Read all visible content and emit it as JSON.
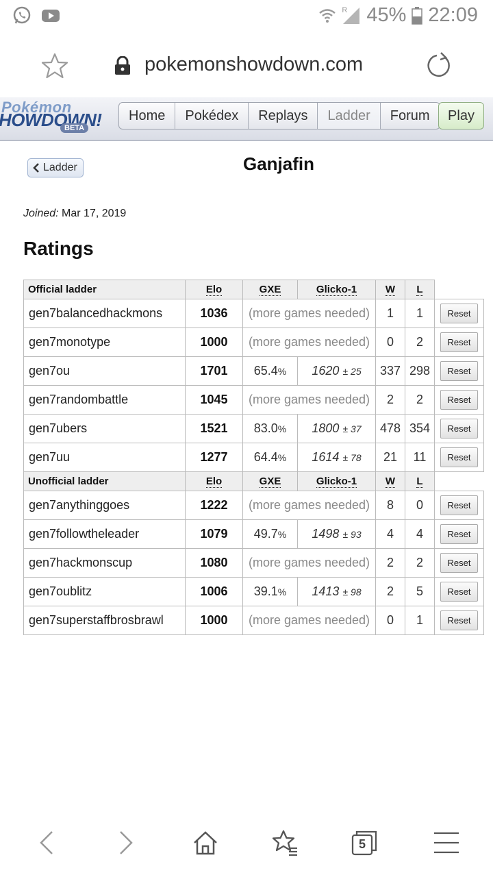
{
  "status_bar": {
    "network_label": "R",
    "battery": "45%",
    "time": "22:09",
    "left_icons": [
      "whatsapp-icon",
      "youtube-icon"
    ]
  },
  "browser": {
    "url": "pokemonshowdown.com"
  },
  "site": {
    "logo_line1": "Pokémon",
    "logo_line2": "HOWDOWN!",
    "logo_beta": "BETA",
    "nav": [
      "Home",
      "Pokédex",
      "Replays",
      "Ladder",
      "Forum"
    ],
    "nav_current": "Ladder",
    "play": "Play"
  },
  "page": {
    "back_label": "Ladder",
    "player_name": "Ganjafin",
    "joined_label": "Joined:",
    "joined_date": "Mar 17, 2019",
    "ratings_title": "Ratings"
  },
  "table": {
    "columns": {
      "elo": "Elo",
      "gxe": "GXE",
      "glicko": "Glicko-1",
      "w": "W",
      "l": "L"
    },
    "reset_label": "Reset",
    "more_games_label": "(more games needed)",
    "sections": [
      {
        "label": "Official ladder",
        "rows": [
          {
            "format": "gen7balancedhackmons",
            "elo": "1036",
            "gxe": null,
            "glicko": null,
            "glicko_dev": null,
            "w": "1",
            "l": "1"
          },
          {
            "format": "gen7monotype",
            "elo": "1000",
            "gxe": null,
            "glicko": null,
            "glicko_dev": null,
            "w": "0",
            "l": "2"
          },
          {
            "format": "gen7ou",
            "elo": "1701",
            "gxe": "65.4",
            "glicko": "1620",
            "glicko_dev": "± 25",
            "w": "337",
            "l": "298"
          },
          {
            "format": "gen7randombattle",
            "elo": "1045",
            "gxe": null,
            "glicko": null,
            "glicko_dev": null,
            "w": "2",
            "l": "2"
          },
          {
            "format": "gen7ubers",
            "elo": "1521",
            "gxe": "83.0",
            "glicko": "1800",
            "glicko_dev": "± 37",
            "w": "478",
            "l": "354"
          },
          {
            "format": "gen7uu",
            "elo": "1277",
            "gxe": "64.4",
            "glicko": "1614",
            "glicko_dev": "± 78",
            "w": "21",
            "l": "11"
          }
        ]
      },
      {
        "label": "Unofficial ladder",
        "rows": [
          {
            "format": "gen7anythinggoes",
            "elo": "1222",
            "gxe": null,
            "glicko": null,
            "glicko_dev": null,
            "w": "8",
            "l": "0"
          },
          {
            "format": "gen7followtheleader",
            "elo": "1079",
            "gxe": "49.7",
            "glicko": "1498",
            "glicko_dev": "± 93",
            "w": "4",
            "l": "4"
          },
          {
            "format": "gen7hackmonscup",
            "elo": "1080",
            "gxe": null,
            "glicko": null,
            "glicko_dev": null,
            "w": "2",
            "l": "2"
          },
          {
            "format": "gen7oublitz",
            "elo": "1006",
            "gxe": "39.1",
            "glicko": "1413",
            "glicko_dev": "± 98",
            "w": "2",
            "l": "5"
          },
          {
            "format": "gen7superstaffbrosbrawl",
            "elo": "1000",
            "gxe": null,
            "glicko": null,
            "glicko_dev": null,
            "w": "0",
            "l": "1"
          }
        ]
      }
    ]
  },
  "bottom_nav": {
    "tab_count": "5",
    "icons": [
      "back-icon",
      "forward-icon",
      "home-icon",
      "bookmarks-icon",
      "tabs-icon",
      "menu-icon"
    ]
  }
}
